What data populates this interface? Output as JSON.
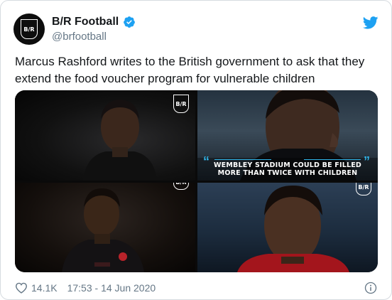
{
  "author": {
    "name": "B/R Football",
    "handle": "@brfootball",
    "avatar_text": "B/R"
  },
  "tweet": {
    "text": "Marcus Rashford writes to the British government to ask that they extend the food voucher program for vulnerable children"
  },
  "media": {
    "logo_text": "B/R",
    "quote_text": "WEMBLEY STADIUM COULD BE FILLED MORE THAN TWICE WITH CHILDREN",
    "quote_open": "“",
    "quote_close": "”"
  },
  "footer": {
    "likes": "14.1K",
    "timestamp": "17:53 - 14 Jun 2020"
  },
  "icons": {
    "verified": "verified-badge-icon",
    "bird": "twitter-bird-icon",
    "heart": "heart-icon",
    "info": "info-icon"
  },
  "colors": {
    "brand_blue": "#1da1f2",
    "text": "#14171a",
    "secondary": "#657786",
    "quote_accent": "#2fb4e8"
  }
}
